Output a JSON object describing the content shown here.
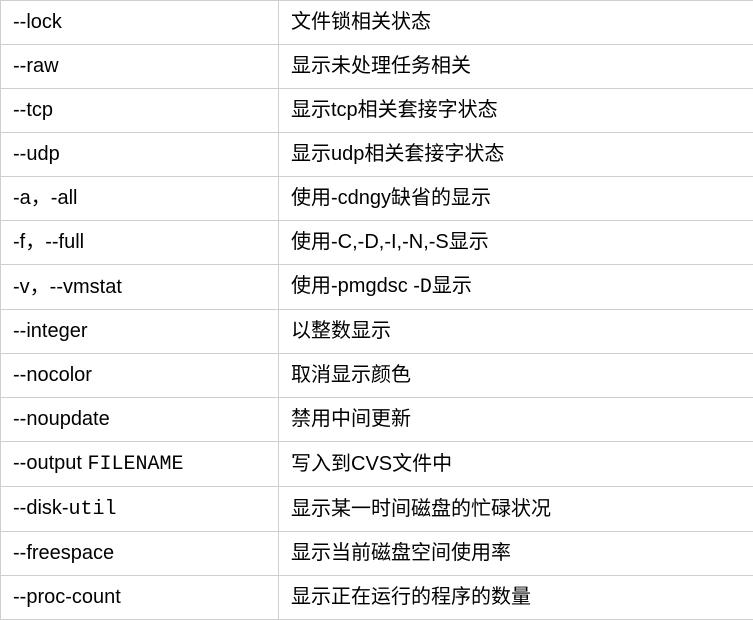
{
  "rows": [
    {
      "option": [
        {
          "t": "--lock",
          "mono": false
        }
      ],
      "desc": [
        {
          "t": "文件锁相关状态",
          "mono": false
        }
      ]
    },
    {
      "option": [
        {
          "t": "--raw",
          "mono": false
        }
      ],
      "desc": [
        {
          "t": "显示未处理任务相关",
          "mono": false
        }
      ]
    },
    {
      "option": [
        {
          "t": "--tcp",
          "mono": false
        }
      ],
      "desc": [
        {
          "t": "显示tcp相关套接字状态",
          "mono": false
        }
      ]
    },
    {
      "option": [
        {
          "t": "--udp",
          "mono": false
        }
      ],
      "desc": [
        {
          "t": "显示udp相关套接字状态",
          "mono": false
        }
      ]
    },
    {
      "option": [
        {
          "t": "-a，-all",
          "mono": false
        }
      ],
      "desc": [
        {
          "t": "使用-cdngy缺省的显示",
          "mono": false
        }
      ]
    },
    {
      "option": [
        {
          "t": "-f，--full",
          "mono": false
        }
      ],
      "desc": [
        {
          "t": "使用-C,-D,-I,-N,-S显示",
          "mono": false
        }
      ]
    },
    {
      "option": [
        {
          "t": "-v，--vmstat",
          "mono": false
        }
      ],
      "desc": [
        {
          "t": "使用-pmgdsc -",
          "mono": false
        },
        {
          "t": "D",
          "mono": true
        },
        {
          "t": "显示",
          "mono": false
        }
      ]
    },
    {
      "option": [
        {
          "t": "--integer",
          "mono": false
        }
      ],
      "desc": [
        {
          "t": "以整数显示",
          "mono": false
        }
      ]
    },
    {
      "option": [
        {
          "t": "--nocolor",
          "mono": false
        }
      ],
      "desc": [
        {
          "t": "取消显示颜色",
          "mono": false
        }
      ]
    },
    {
      "option": [
        {
          "t": "--noupdate",
          "mono": false
        }
      ],
      "desc": [
        {
          "t": "禁用中间更新",
          "mono": false
        }
      ]
    },
    {
      "option": [
        {
          "t": "--output ",
          "mono": false
        },
        {
          "t": "FILENAME",
          "mono": true
        }
      ],
      "desc": [
        {
          "t": "写入到CVS文件中",
          "mono": false
        }
      ]
    },
    {
      "option": [
        {
          "t": "--disk-",
          "mono": false
        },
        {
          "t": "util",
          "mono": true
        }
      ],
      "desc": [
        {
          "t": "显示某一时间磁盘的忙碌状况",
          "mono": false
        }
      ]
    },
    {
      "option": [
        {
          "t": "--freespace",
          "mono": false
        }
      ],
      "desc": [
        {
          "t": "显示当前磁盘空间使用率",
          "mono": false
        }
      ]
    },
    {
      "option": [
        {
          "t": "--proc-count",
          "mono": false
        }
      ],
      "desc": [
        {
          "t": "显示正在运行的程序的数量",
          "mono": false
        }
      ]
    }
  ]
}
